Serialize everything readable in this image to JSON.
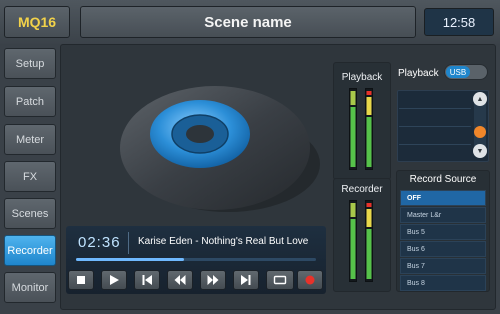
{
  "header": {
    "brand": "MQ16",
    "scene_name": "Scene name",
    "clock": "12:58"
  },
  "sidebar": {
    "items": [
      {
        "label": "Setup"
      },
      {
        "label": "Patch"
      },
      {
        "label": "Meter"
      },
      {
        "label": "FX"
      },
      {
        "label": "Scenes"
      },
      {
        "label": "Recorder",
        "active": true
      },
      {
        "label": "Monitor"
      }
    ]
  },
  "player": {
    "time": "02:36",
    "track_title": "Karise Eden - Nothing's Real But Love",
    "progress": 0.45,
    "controls": [
      "stop",
      "play",
      "previous",
      "rewind",
      "fast-forward",
      "next",
      "loop",
      "record"
    ]
  },
  "meters": {
    "playback_label": "Playback",
    "recorder_label": "Recorder"
  },
  "playback": {
    "label": "Playback",
    "source_badge": "USB"
  },
  "record_source": {
    "title": "Record Source",
    "items": [
      "OFF",
      "Master L&r",
      "Bus 5",
      "Bus 6",
      "Bus 7",
      "Bus 8"
    ],
    "selected": "OFF"
  },
  "colors": {
    "brand_text": "#f2d24a",
    "accent_blue": "#1f86cc",
    "record_red": "#e8322a",
    "scroll_thumb": "#f0862a"
  }
}
